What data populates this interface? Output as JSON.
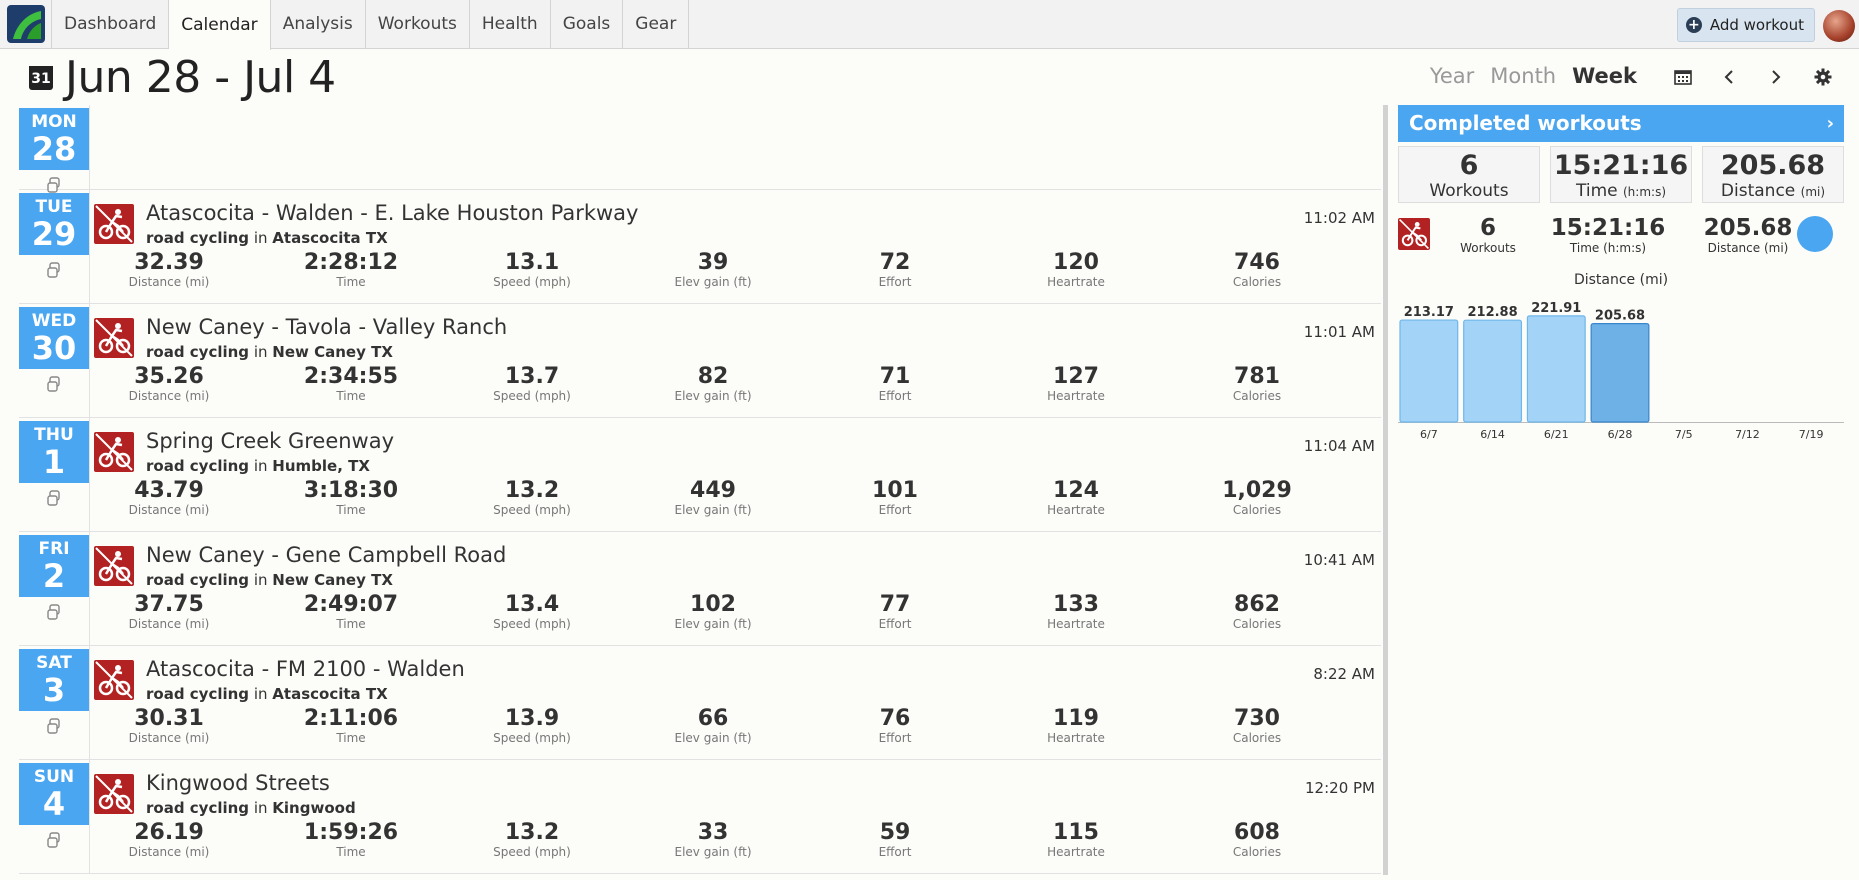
{
  "nav": {
    "tabs": [
      "Dashboard",
      "Calendar",
      "Analysis",
      "Workouts",
      "Health",
      "Goals",
      "Gear"
    ],
    "active": "Calendar",
    "add_workout": "Add workout"
  },
  "header": {
    "calendar_icon_day": "31",
    "title": "Jun 28 - Jul 4",
    "views": [
      "Year",
      "Month",
      "Week"
    ],
    "selected_view": "Week"
  },
  "days": [
    {
      "dow": "MON",
      "num": "28",
      "workout": null
    },
    {
      "dow": "TUE",
      "num": "29",
      "workout": {
        "title": "Atascocita - Walden - E. Lake Houston Parkway",
        "sport": "road cycling",
        "in": "in",
        "location": "Atascocita TX",
        "time": "11:02 AM",
        "metrics": [
          [
            "32.39",
            "Distance (mi)"
          ],
          [
            "2:28:12",
            "Time"
          ],
          [
            "13.1",
            "Speed (mph)"
          ],
          [
            "39",
            "Elev gain (ft)"
          ],
          [
            "72",
            "Effort"
          ],
          [
            "120",
            "Heartrate"
          ],
          [
            "746",
            "Calories"
          ]
        ]
      }
    },
    {
      "dow": "WED",
      "num": "30",
      "workout": {
        "title": "New Caney - Tavola - Valley Ranch",
        "sport": "road cycling",
        "in": "in",
        "location": "New Caney TX",
        "time": "11:01 AM",
        "metrics": [
          [
            "35.26",
            "Distance (mi)"
          ],
          [
            "2:34:55",
            "Time"
          ],
          [
            "13.7",
            "Speed (mph)"
          ],
          [
            "82",
            "Elev gain (ft)"
          ],
          [
            "71",
            "Effort"
          ],
          [
            "127",
            "Heartrate"
          ],
          [
            "781",
            "Calories"
          ]
        ]
      }
    },
    {
      "dow": "THU",
      "num": "1",
      "workout": {
        "title": "Spring Creek Greenway",
        "sport": "road cycling",
        "in": "in",
        "location": "Humble, TX",
        "time": "11:04 AM",
        "metrics": [
          [
            "43.79",
            "Distance (mi)"
          ],
          [
            "3:18:30",
            "Time"
          ],
          [
            "13.2",
            "Speed (mph)"
          ],
          [
            "449",
            "Elev gain (ft)"
          ],
          [
            "101",
            "Effort"
          ],
          [
            "124",
            "Heartrate"
          ],
          [
            "1,029",
            "Calories"
          ]
        ]
      }
    },
    {
      "dow": "FRI",
      "num": "2",
      "workout": {
        "title": "New Caney - Gene Campbell Road",
        "sport": "road cycling",
        "in": "in",
        "location": "New Caney TX",
        "time": "10:41 AM",
        "metrics": [
          [
            "37.75",
            "Distance (mi)"
          ],
          [
            "2:49:07",
            "Time"
          ],
          [
            "13.4",
            "Speed (mph)"
          ],
          [
            "102",
            "Elev gain (ft)"
          ],
          [
            "77",
            "Effort"
          ],
          [
            "133",
            "Heartrate"
          ],
          [
            "862",
            "Calories"
          ]
        ]
      }
    },
    {
      "dow": "SAT",
      "num": "3",
      "workout": {
        "title": "Atascocita - FM 2100 - Walden",
        "sport": "road cycling",
        "in": "in",
        "location": "Atascocita TX",
        "time": "8:22 AM",
        "metrics": [
          [
            "30.31",
            "Distance (mi)"
          ],
          [
            "2:11:06",
            "Time"
          ],
          [
            "13.9",
            "Speed (mph)"
          ],
          [
            "66",
            "Elev gain (ft)"
          ],
          [
            "76",
            "Effort"
          ],
          [
            "119",
            "Heartrate"
          ],
          [
            "730",
            "Calories"
          ]
        ]
      }
    },
    {
      "dow": "SUN",
      "num": "4",
      "workout": {
        "title": "Kingwood Streets",
        "sport": "road cycling",
        "in": "in",
        "location": "Kingwood",
        "time": "12:20 PM",
        "metrics": [
          [
            "26.19",
            "Distance (mi)"
          ],
          [
            "1:59:26",
            "Time"
          ],
          [
            "13.2",
            "Speed (mph)"
          ],
          [
            "33",
            "Elev gain (ft)"
          ],
          [
            "59",
            "Effort"
          ],
          [
            "115",
            "Heartrate"
          ],
          [
            "608",
            "Calories"
          ]
        ]
      }
    }
  ],
  "summary": {
    "header": "Completed workouts",
    "boxes": [
      {
        "value": "6",
        "label": "Workouts",
        "unit": ""
      },
      {
        "value": "15:21:16",
        "label": "Time",
        "unit": "(h:m:s)"
      },
      {
        "value": "205.68",
        "label": "Distance",
        "unit": "(mi)"
      }
    ],
    "row": [
      {
        "value": "6",
        "label": "Workouts"
      },
      {
        "value": "15:21:16",
        "label": "Time (h:m:s)"
      },
      {
        "value": "205.68",
        "label": "Distance (mi)"
      }
    ]
  },
  "chart_data": {
    "type": "bar",
    "title": "Distance (mi)",
    "categories": [
      "6/7",
      "6/14",
      "6/21",
      "6/28",
      "7/5",
      "7/12",
      "7/19"
    ],
    "values": [
      213.17,
      212.88,
      221.91,
      205.68,
      null,
      null,
      null
    ],
    "value_labels": [
      "213.17",
      "212.88",
      "221.91",
      "205.68"
    ],
    "highlight": "6/28",
    "colors": {
      "bar": "#a3d4f7",
      "bar_border": "#6fb6ea",
      "highlight": "#6eb1e6",
      "highlight_border": "#3a86cc"
    }
  }
}
